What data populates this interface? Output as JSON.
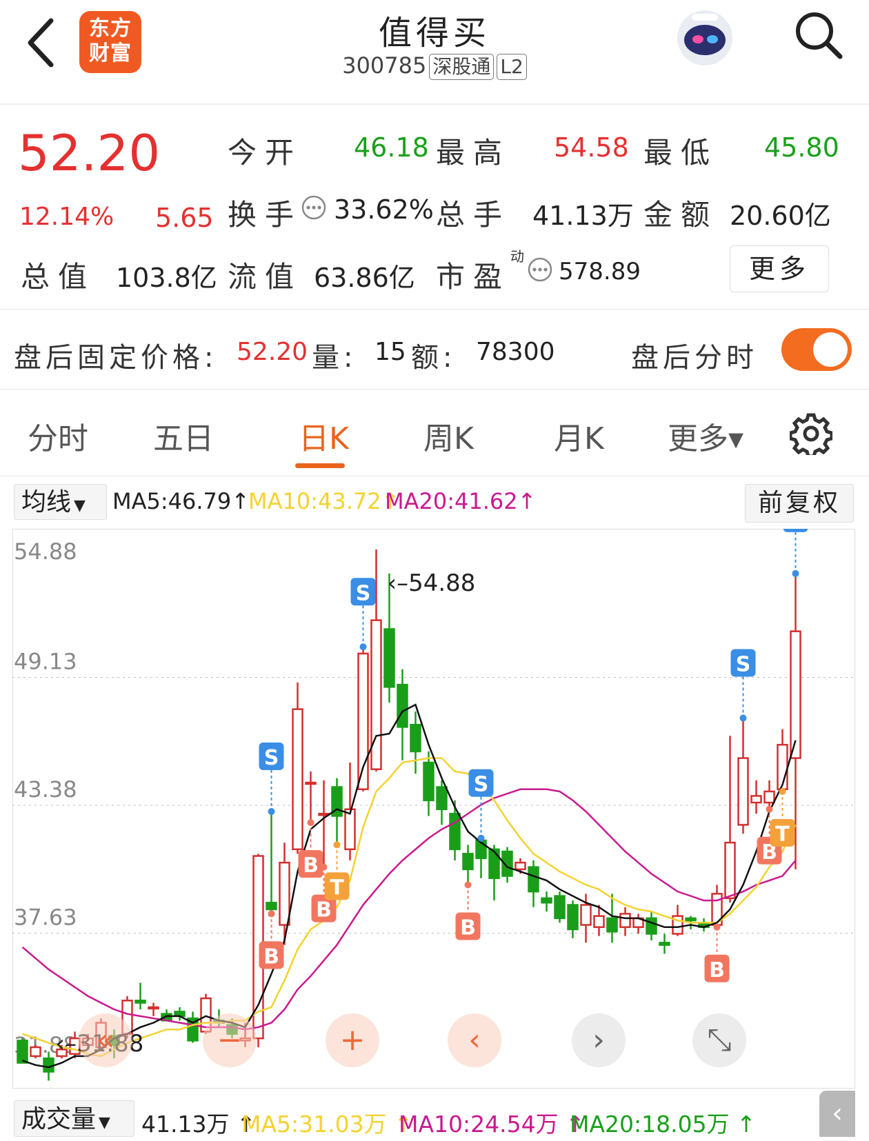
{
  "header": {
    "logo": [
      "东方",
      "财富"
    ],
    "title": "值得买",
    "code": "300785",
    "tag_sgt": "深股通",
    "tag_l2": "L2"
  },
  "quote": {
    "price": "52.20",
    "change_pct": "12.14%",
    "change": "5.65",
    "open_label": "今开",
    "open": "46.18",
    "high_label": "最高",
    "high": "54.58",
    "low_label": "最低",
    "low": "45.80",
    "turnover_label": "换手",
    "turnover": "33.62%",
    "volume_label": "总手",
    "volume": "41.13万",
    "amount_label": "金额",
    "amount": "20.60亿",
    "mktcap_label": "总值",
    "mktcap": "103.8亿",
    "float_label": "流值",
    "float": "63.86亿",
    "pe_label": "市盈",
    "pe_sup": "动",
    "pe": "578.89",
    "more": "更多"
  },
  "after_hours": {
    "label": "盘后固定价格:",
    "price": "52.20",
    "vol_label": "量:",
    "vol": "15",
    "amt_label": "额:",
    "amt": "78300",
    "toggle_label": "盘后分时",
    "toggle_on": true
  },
  "tabs": [
    "分时",
    "五日",
    "日K",
    "周K",
    "月K",
    "更多▾"
  ],
  "active_tab": "日K",
  "ma": {
    "selector": "均线",
    "ma5": "MA5:46.79",
    "ma10": "MA10:43.72",
    "ma20": "MA20:41.62",
    "adjust": "前复权",
    "colors": {
      "ma5": "#111111",
      "ma10": "#f5d22e",
      "ma20": "#c9198f",
      "up": "#d32f2f",
      "down": "#1a9e1a"
    }
  },
  "chart_data": {
    "type": "candlestick",
    "y_ticks": [
      "54.88",
      "49.13",
      "43.38",
      "37.63",
      "31.88"
    ],
    "ylim": [
      31.88,
      54.88
    ],
    "max_label": "54.88",
    "min_label": "31.88",
    "candles": [
      [
        32.8,
        31.8,
        32.9,
        31.8
      ],
      [
        32.1,
        32.5,
        32.6,
        32.0
      ],
      [
        32.0,
        31.4,
        32.3,
        31.0
      ],
      [
        32.1,
        32.4,
        32.6,
        32.0
      ],
      [
        32.2,
        32.9,
        33.2,
        32.0
      ],
      [
        32.6,
        32.9,
        33.1,
        32.5
      ],
      [
        32.5,
        33.6,
        33.8,
        32.5
      ],
      [
        33.0,
        32.6,
        33.3,
        32.0
      ],
      [
        33.1,
        34.6,
        34.8,
        32.9
      ],
      [
        34.6,
        34.5,
        35.4,
        34.2
      ],
      [
        34.3,
        34.3,
        34.5,
        33.9
      ],
      [
        34.0,
        33.7,
        34.2,
        33.8
      ],
      [
        34.1,
        33.9,
        34.3,
        33.7
      ],
      [
        33.8,
        32.8,
        34.1,
        32.7
      ],
      [
        33.2,
        34.7,
        34.9,
        33.1
      ],
      [
        33.7,
        33.6,
        34.2,
        33.4
      ],
      [
        33.5,
        33.1,
        33.8,
        32.9
      ],
      [
        32.8,
        32.9,
        33.6,
        32.5
      ],
      [
        32.9,
        41.1,
        41.2,
        32.5
      ],
      [
        39.0,
        38.7,
        43.1,
        38.5
      ],
      [
        38.0,
        40.8,
        41.7,
        37.1
      ],
      [
        41.4,
        47.7,
        48.9,
        41.2
      ],
      [
        44.4,
        44.4,
        44.9,
        42.6
      ],
      [
        43.0,
        43.0,
        44.5,
        40.6
      ],
      [
        44.2,
        42.9,
        44.6,
        41.6
      ],
      [
        41.4,
        43.2,
        45.3,
        40.9
      ],
      [
        44.1,
        50.2,
        50.5,
        44.0
      ],
      [
        45.0,
        51.7,
        54.88,
        44.9
      ],
      [
        51.3,
        48.7,
        53.8,
        48.0
      ],
      [
        48.8,
        46.9,
        49.5,
        45.4
      ],
      [
        47.0,
        45.8,
        47.6,
        44.8
      ],
      [
        45.3,
        43.6,
        45.8,
        42.9
      ],
      [
        44.2,
        43.2,
        44.5,
        42.5
      ],
      [
        43.0,
        41.4,
        43.6,
        40.9
      ],
      [
        41.2,
        40.5,
        41.6,
        39.8
      ],
      [
        41.8,
        41.0,
        41.9,
        40.1
      ],
      [
        41.4,
        40.1,
        41.6,
        39.1
      ],
      [
        41.3,
        40.2,
        41.5,
        39.9
      ],
      [
        40.5,
        40.8,
        41.0,
        40.3
      ],
      [
        40.6,
        39.5,
        40.9,
        38.8
      ],
      [
        39.2,
        39.0,
        39.5,
        38.6
      ],
      [
        39.3,
        38.3,
        39.5,
        38.1
      ],
      [
        38.9,
        37.8,
        39.1,
        37.4
      ],
      [
        38.0,
        38.9,
        39.4,
        37.2
      ],
      [
        37.9,
        38.4,
        38.9,
        37.5
      ],
      [
        38.3,
        37.7,
        39.4,
        37.2
      ],
      [
        37.9,
        38.5,
        38.8,
        37.5
      ],
      [
        37.9,
        38.3,
        38.5,
        37.6
      ],
      [
        38.3,
        37.6,
        38.6,
        37.3
      ],
      [
        37.2,
        37.1,
        37.6,
        36.7
      ],
      [
        37.6,
        38.4,
        38.9,
        37.5
      ],
      [
        38.3,
        38.2,
        38.4,
        37.8
      ],
      [
        38.1,
        37.9,
        38.3,
        37.7
      ],
      [
        38.0,
        39.4,
        39.8,
        37.9
      ],
      [
        39.2,
        41.7,
        46.5,
        39.0
      ],
      [
        42.5,
        45.5,
        47.3,
        42.1
      ],
      [
        43.5,
        43.8,
        44.5,
        43.0
      ],
      [
        43.5,
        44.0,
        44.5,
        43.2
      ],
      [
        44.1,
        46.1,
        46.8,
        44.0
      ],
      [
        45.5,
        51.2,
        53.8,
        40.5
      ]
    ],
    "ma5": [
      31.9,
      31.7,
      31.6,
      31.8,
      32.1,
      32.1,
      32.4,
      32.9,
      33.1,
      33.4,
      33.6,
      33.9,
      33.9,
      33.6,
      33.9,
      33.7,
      33.6,
      33.4,
      34.4,
      35.8,
      37.3,
      40.4,
      42.3,
      42.8,
      43.2,
      43.0,
      45.1,
      46.5,
      46.6,
      47.6,
      47.9,
      46.1,
      44.6,
      43.3,
      42.2,
      41.7,
      41.3,
      40.6,
      40.4,
      40.2,
      40.0,
      39.6,
      39.3,
      39.0,
      38.8,
      38.4,
      38.3,
      38.3,
      38.1,
      37.9,
      37.9,
      38.0,
      37.9,
      38.1,
      38.7,
      39.8,
      41.3,
      43.1,
      44.3,
      46.3
    ],
    "ma10": [
      33.1,
      32.9,
      32.7,
      32.5,
      32.4,
      32.2,
      32.1,
      32.4,
      32.7,
      32.9,
      33.1,
      33.3,
      33.3,
      33.5,
      33.6,
      33.6,
      33.7,
      33.7,
      34.1,
      34.3,
      35.5,
      36.9,
      37.8,
      38.2,
      38.8,
      40.0,
      42.4,
      44.0,
      44.6,
      45.3,
      45.4,
      45.5,
      45.5,
      44.9,
      44.8,
      44.3,
      43.6,
      42.7,
      41.9,
      41.2,
      40.8,
      40.4,
      40.1,
      39.8,
      39.6,
      39.2,
      38.9,
      38.7,
      38.6,
      38.4,
      38.2,
      38.1,
      38.1,
      38.1,
      38.5,
      39.1,
      39.7,
      40.6,
      41.3,
      42.5
    ],
    "ma20": [
      37.0,
      36.5,
      36.0,
      35.6,
      35.2,
      34.8,
      34.5,
      34.2,
      34.0,
      33.9,
      33.8,
      33.7,
      33.6,
      33.5,
      33.4,
      33.4,
      33.4,
      33.3,
      33.4,
      33.6,
      34.2,
      35.1,
      35.7,
      36.4,
      37.1,
      38.0,
      38.9,
      39.6,
      40.3,
      40.9,
      41.4,
      41.9,
      42.3,
      42.6,
      43.0,
      43.4,
      43.7,
      43.9,
      44.1,
      44.1,
      44.1,
      44.0,
      43.6,
      43.1,
      42.5,
      41.9,
      41.3,
      40.8,
      40.3,
      39.9,
      39.5,
      39.3,
      39.1,
      39.1,
      39.3,
      39.5,
      39.8,
      40.0,
      40.2,
      40.9
    ],
    "signals": [
      {
        "type": "S",
        "index": 19
      },
      {
        "type": "B",
        "index": 19
      },
      {
        "type": "B",
        "index": 22
      },
      {
        "type": "B",
        "index": 23
      },
      {
        "type": "T",
        "index": 24
      },
      {
        "type": "S",
        "index": 26
      },
      {
        "type": "S",
        "index": 35
      },
      {
        "type": "B",
        "index": 34
      },
      {
        "type": "B",
        "index": 53
      },
      {
        "type": "S",
        "index": 55
      },
      {
        "type": "B",
        "index": 57
      },
      {
        "type": "T",
        "index": 58
      },
      {
        "type": "S",
        "index": 59
      }
    ]
  },
  "controls": [
    "«",
    "−",
    "+",
    "‹",
    "›",
    "⤡"
  ],
  "volume_bar": {
    "selector": "成交量",
    "vol": "41.13万",
    "ma5": "MA5:31.03万",
    "ma10": "MA10:24.54万",
    "ma20": "MA20:18.05万",
    "corner": "‹"
  }
}
